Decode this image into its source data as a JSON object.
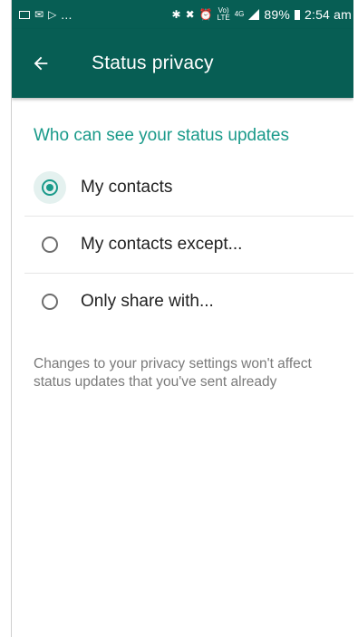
{
  "status_bar": {
    "left_icons": [
      "image-icon",
      "mail-icon",
      "play-store-icon"
    ],
    "overflow": "...",
    "right_icons": [
      "bluetooth-icon",
      "mute-icon",
      "alarm-icon",
      "volte-icon"
    ],
    "network_small_top": "Vo)",
    "network_small_bottom": "LTE",
    "network_type": "4G",
    "battery": "89%",
    "time": "2:54 am"
  },
  "toolbar": {
    "title": "Status privacy",
    "background": "#075e54"
  },
  "section": {
    "header": "Who can see your status updates",
    "accent": "#1a9a8a"
  },
  "options": [
    {
      "label": "My contacts",
      "selected": true
    },
    {
      "label": "My contacts except...",
      "selected": false
    },
    {
      "label": "Only share with...",
      "selected": false
    }
  ],
  "note": "Changes to your privacy settings won't affect status updates that you've sent already"
}
